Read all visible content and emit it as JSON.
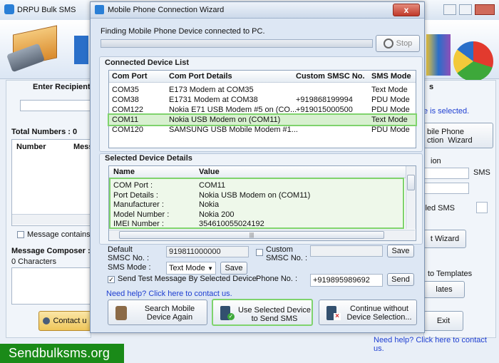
{
  "background": {
    "title": "DRPU Bulk SMS",
    "enter_recipient": "Enter Recipient",
    "total_numbers": "Total Numbers : 0",
    "col_number": "Number",
    "col_message": "Mess",
    "message_contains": "Message contains n",
    "message_composer": "Message Composer :",
    "characters": "0 Characters",
    "contact_btn": "Contact u",
    "right_s": "s",
    "right_selected": "e is selected.",
    "mobile_phone_wizard": "bile Phone\nction  Wizard",
    "right_ion": "ion",
    "right_sms": "SMS",
    "right_iled_sms": "iled SMS",
    "right_wizard_btn": "t Wizard",
    "right_templates": "to Templates",
    "right_lates_btn": "lates",
    "exit_btn": "Exit",
    "need_help": "Need help? Click here to contact us.",
    "watermark": "Sendbulksms.org"
  },
  "dialog": {
    "title": "Mobile Phone Connection Wizard",
    "close_label": "x",
    "finding_text": "Finding Mobile Phone Device connected to PC.",
    "progress": 1.0,
    "stop_label": "Stop",
    "connected_title": "Connected Device List",
    "connected_headers": [
      "Com Port",
      "Com Port Details",
      "Custom SMSC No.",
      "SMS Mode"
    ],
    "connected_rows": [
      [
        "COM35",
        "E173 Modem at COM35",
        "",
        "Text Mode"
      ],
      [
        "COM38",
        "E1731 Modem at COM38",
        "+919868199994",
        "PDU Mode"
      ],
      [
        "COM122",
        "Nokia E71 USB Modem #5 on (CO...",
        "+919015000500",
        "PDU Mode"
      ],
      [
        "COM11",
        "Nokia USB Modem on (COM11)",
        "",
        "Text Mode"
      ],
      [
        "COM120",
        "SAMSUNG USB Mobile Modem #1...",
        "",
        "PDU Mode"
      ]
    ],
    "selected_row_index": 3,
    "selected_title": "Selected Device Details",
    "selected_headers": [
      "Name",
      "Value"
    ],
    "selected_rows": [
      [
        "COM Port :",
        "COM11"
      ],
      [
        "Port Details :",
        "Nokia USB Modem on (COM11)"
      ],
      [
        "Manufacturer :",
        "Nokia"
      ],
      [
        "Model Number :",
        "Nokia 200"
      ],
      [
        "IMEI Number :",
        "354610055024192"
      ]
    ],
    "default_smsc_label": "Default\nSMSC No. :",
    "default_smsc_value": "919811000000",
    "custom_smsc_label": "Custom\nSMSC No. :",
    "custom_smsc_value": "",
    "save_label": "Save",
    "sms_mode_label": "SMS Mode :",
    "sms_mode_value": "Text Mode",
    "send_test_label": "Send Test Message By Selected Device",
    "phone_no_label": "Phone No. :",
    "phone_no_value": "+919895989692",
    "send_label": "Send",
    "help_link": "Need help? Click here to contact us.",
    "btn_search": "Search Mobile\nDevice Again",
    "btn_use": "Use Selected Device\nto Send SMS",
    "btn_continue": "Continue without\nDevice Selection..."
  },
  "colors": {
    "highlight_green": "#7fd36d",
    "link_blue": "#1f3fd1",
    "watermark_green": "#1a8a18"
  }
}
